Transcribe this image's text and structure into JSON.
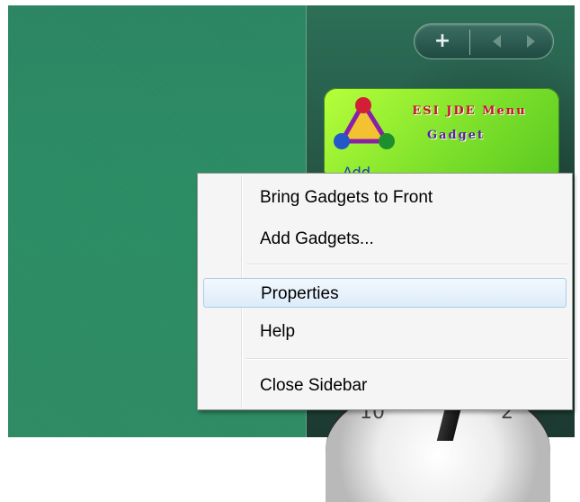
{
  "sidebar_controls": {
    "add_glyph": "+",
    "add_icon": "plus-icon",
    "prev_icon": "triangle-left-icon",
    "next_icon": "triangle-right-icon"
  },
  "gadget": {
    "title": "ESI JDE Menu",
    "subtitle": "Gadget",
    "link_text": "Add..."
  },
  "clock": {
    "numeral_left": "10",
    "numeral_right": "2"
  },
  "context_menu": {
    "items": [
      {
        "label": "Bring Gadgets to Front"
      },
      {
        "label": "Add Gadgets..."
      },
      {
        "label": "Properties"
      },
      {
        "label": "Help"
      },
      {
        "label": "Close Sidebar"
      }
    ],
    "highlighted_item": "Properties"
  },
  "colors": {
    "desktop_green": "#2a8b63",
    "gadget_green": "#7ee12b",
    "menu_background": "#f5f5f5",
    "menu_highlight": "#ddecfa"
  }
}
